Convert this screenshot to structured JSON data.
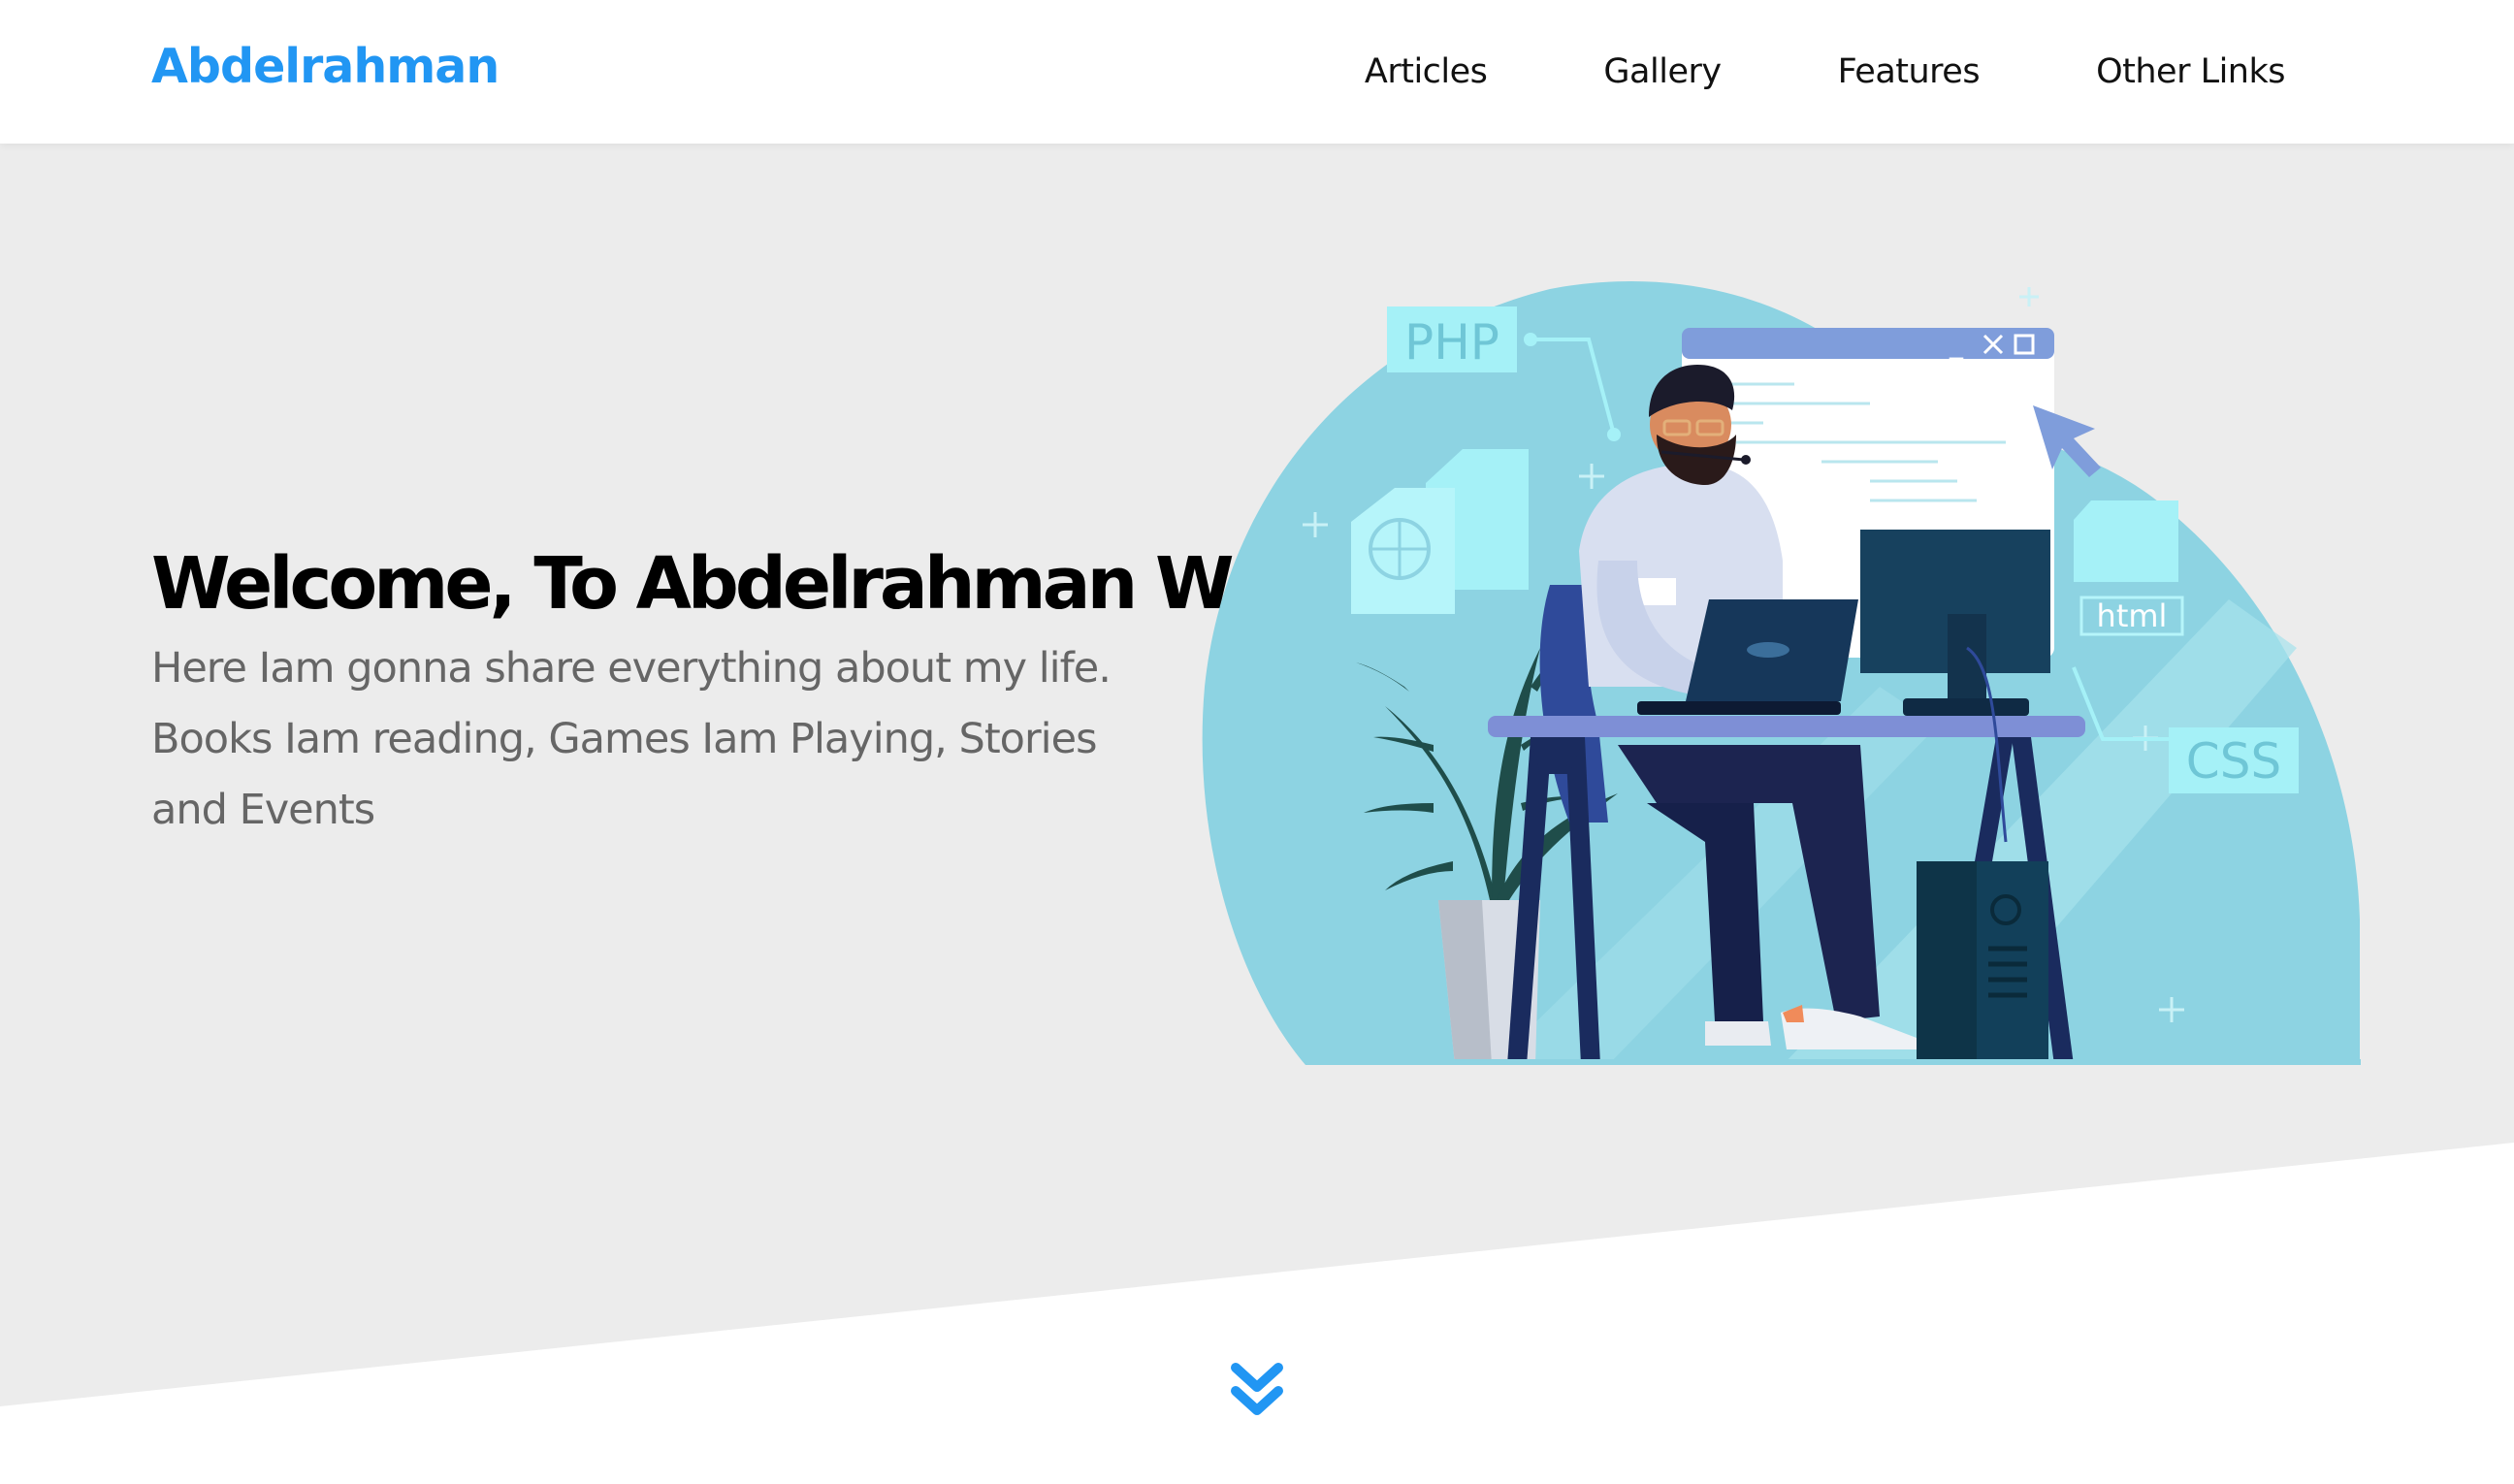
{
  "header": {
    "logo": "Abdelrahman",
    "nav": [
      {
        "label": "Articles"
      },
      {
        "label": "Gallery"
      },
      {
        "label": "Features"
      },
      {
        "label": "Other Links"
      }
    ]
  },
  "hero": {
    "title": "Welcome, To Abdelrahman World",
    "description": "Here Iam gonna share everything about my life. Books Iam reading, Games Iam Playing, Stories and Events"
  },
  "illustration": {
    "tags": {
      "php": "PHP",
      "html": "html",
      "css": "CSS"
    }
  },
  "colors": {
    "accent": "#2196f3",
    "hero_bg": "#ececec",
    "illustration_bg": "#8dd3e2",
    "tag_bg": "#a5f1f7",
    "desk": "#7e8fd6",
    "navy": "#1a2b5e"
  },
  "icons": {
    "scroll_down": "double-chevron-down-icon"
  }
}
